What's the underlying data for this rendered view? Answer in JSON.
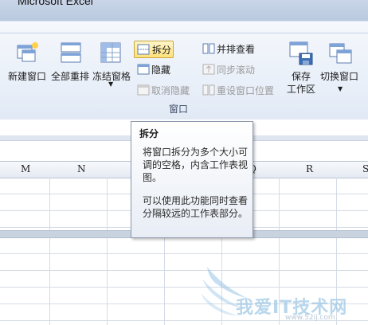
{
  "app": {
    "title": "Microsoft Excel"
  },
  "ribbon": {
    "buttons_large": [
      {
        "id": "new-window",
        "label": "新建窗口"
      },
      {
        "id": "arrange-all",
        "label": "全部重排"
      },
      {
        "id": "freeze-panes",
        "label": "冻结窗格"
      },
      {
        "id": "save-workspace",
        "label": "保存\n工作区"
      },
      {
        "id": "switch-windows",
        "label": "切换窗口"
      }
    ],
    "split": {
      "label": "拆分"
    },
    "hide": {
      "label": "隐藏"
    },
    "unhide": {
      "label": "取消隐藏"
    },
    "view_side_by_side": {
      "label": "并排查看"
    },
    "sync_scroll": {
      "label": "同步滚动"
    },
    "reset_position": {
      "label": "重设窗口位置"
    },
    "group_label": "窗口"
  },
  "tooltip": {
    "title": "拆分",
    "paragraph1": "将窗口拆分为多个大小可调的空格，内含工作表视图。",
    "paragraph2": "可以使用此功能同时查看分隔较远的工作表部分。"
  },
  "sheet": {
    "columns": [
      "M",
      "N",
      "Q",
      "R",
      "S"
    ]
  },
  "watermark": {
    "text": "我爱IT技术网",
    "url": "www.52ij.com"
  }
}
